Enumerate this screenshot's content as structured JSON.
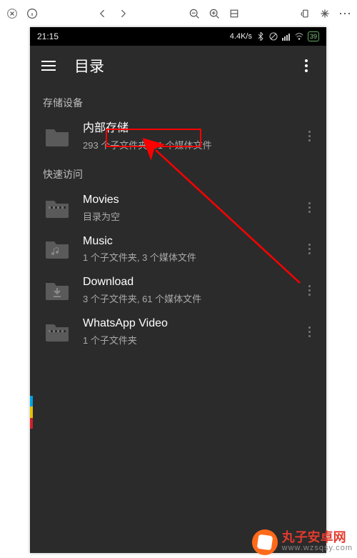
{
  "outerToolbar": {
    "zoom_out": "−",
    "zoom_in": "+"
  },
  "statusBar": {
    "time": "21:15",
    "netSpeed": "4.4K/s",
    "battery": "39"
  },
  "header": {
    "title": "目录"
  },
  "sections": [
    {
      "label": "存储设备"
    },
    {
      "label": "快速访问"
    }
  ],
  "rows": {
    "internal": {
      "title": "内部存储",
      "sub": "293 个子文件夹, 51 个媒体文件"
    },
    "movies": {
      "title": "Movies",
      "sub": "目录为空"
    },
    "music": {
      "title": "Music",
      "sub": "1 个子文件夹, 3 个媒体文件"
    },
    "download": {
      "title": "Download",
      "sub": "3 个子文件夹, 61 个媒体文件"
    },
    "whatsapp": {
      "title": "WhatsApp Video",
      "sub": "1 个子文件夹"
    }
  },
  "watermark": {
    "name": "丸子安卓网",
    "url": "www.wzsqsy.com"
  }
}
